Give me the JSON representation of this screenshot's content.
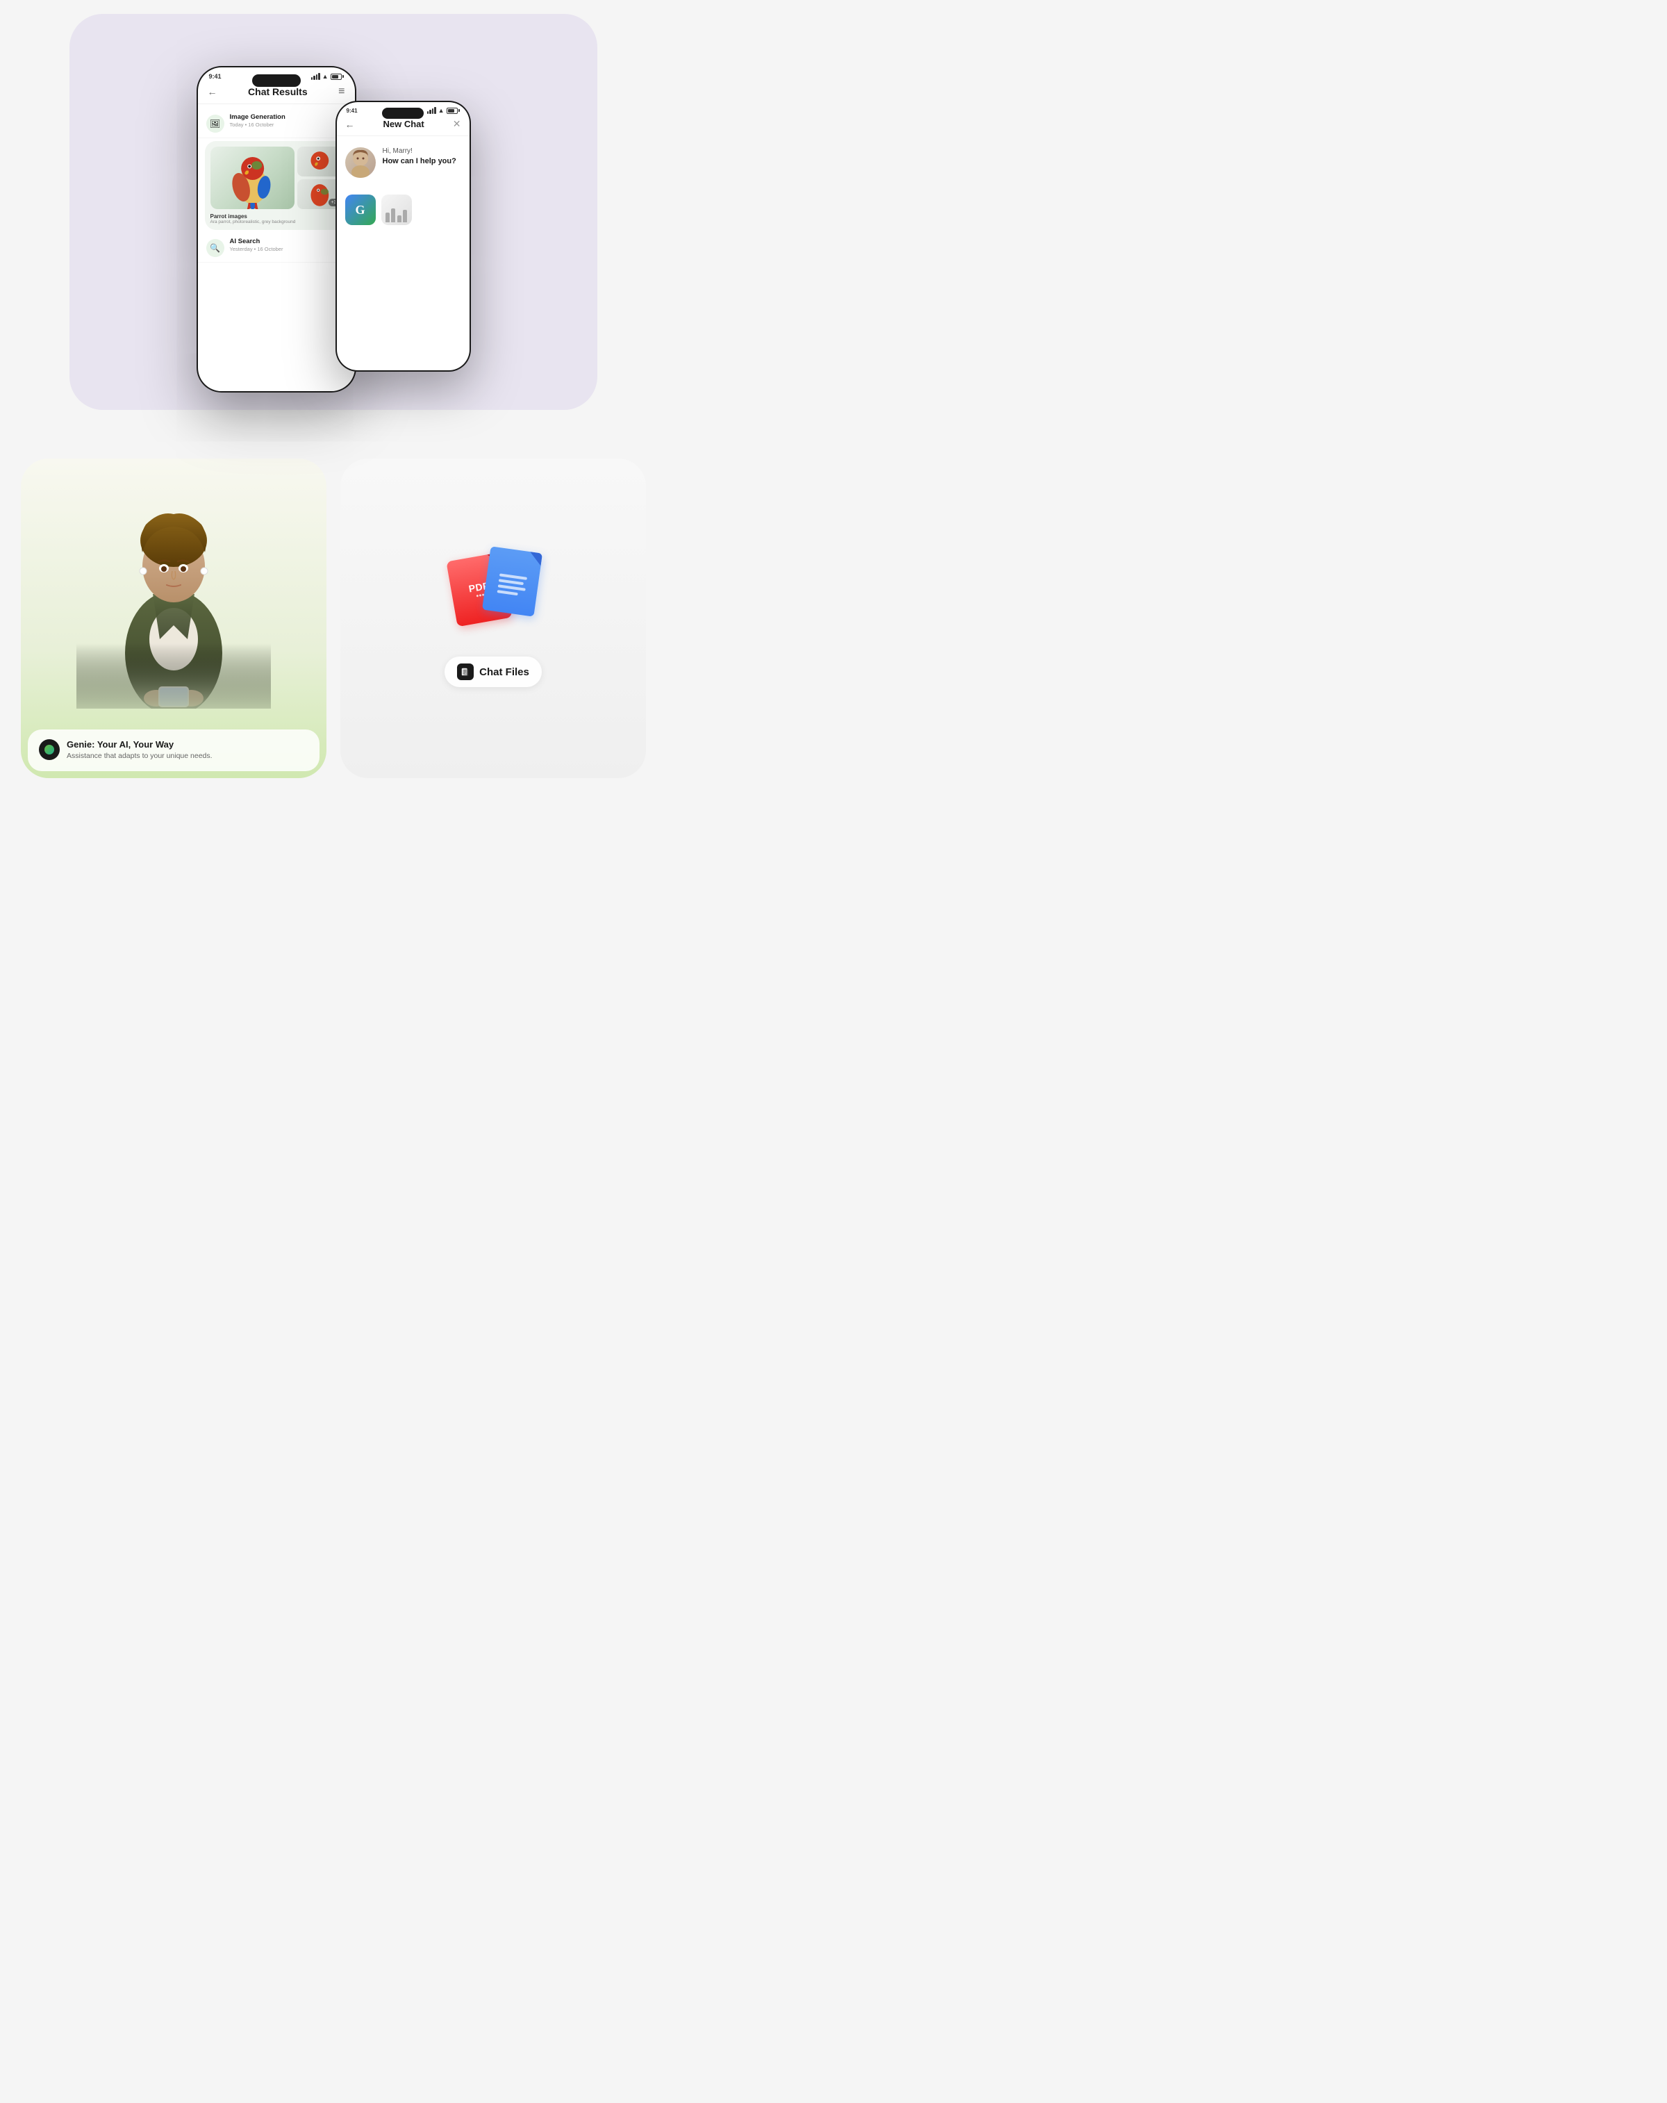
{
  "page": {
    "background": "#f5f5f5"
  },
  "top_section": {
    "bg_color": "#e8e4f0"
  },
  "phone1": {
    "status_time": "9:41",
    "title": "Chat Results",
    "back_label": "←",
    "menu_label": "≡",
    "items": [
      {
        "name": "Image Generation",
        "date": "Today • 16 October",
        "icon": "🖼"
      },
      {
        "name": "Parrot images",
        "desc": "Ara parrot, photorealistic, grey background",
        "icon": "🦜"
      },
      {
        "name": "AI Search",
        "date": "Yesterday • 16 October",
        "icon": "🔍"
      }
    ],
    "plus_badge": "+3"
  },
  "phone2": {
    "status_time": "9:41",
    "title": "New Chat",
    "close_label": "✕",
    "back_label": "←",
    "greeting": "Hi, Marry!",
    "help_text": "How can I help you?"
  },
  "genie_card": {
    "title": "Genie: Your AI, Your Way",
    "subtitle": "Assistance that adapts to your unique needs."
  },
  "files_card": {
    "label": "Chat Files",
    "pdf_label": "PDF",
    "pdf_sublabel": "Document"
  }
}
